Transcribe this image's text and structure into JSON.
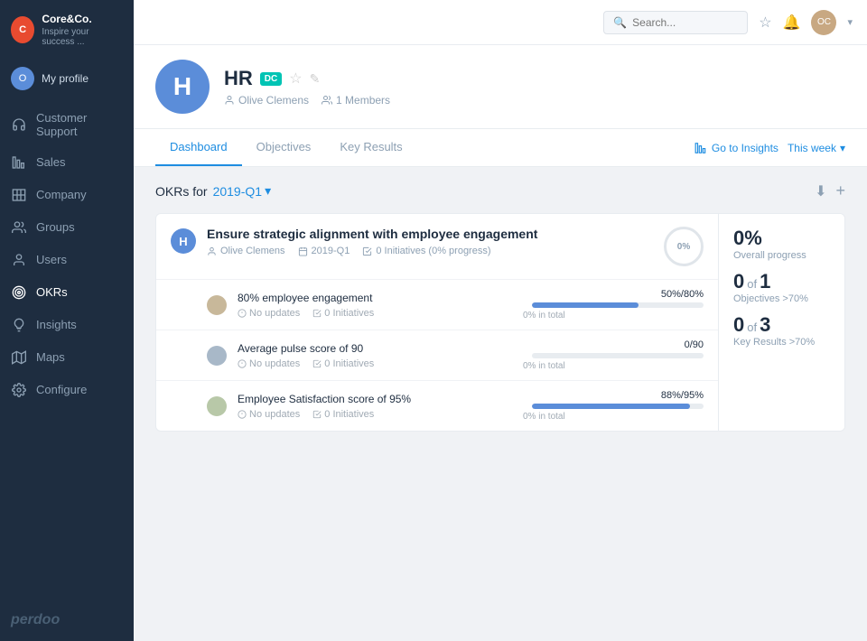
{
  "sidebar": {
    "logo_initials": "C",
    "company_name": "Core&Co.",
    "company_tagline": "Inspire your success ...",
    "profile": {
      "initials": "O",
      "name": "My profile"
    },
    "nav_items": [
      {
        "id": "customer-support",
        "label": "Customer Support",
        "icon": "headset"
      },
      {
        "id": "sales",
        "label": "Sales",
        "icon": "chart-bar"
      },
      {
        "id": "company",
        "label": "Company",
        "icon": "building"
      },
      {
        "id": "groups",
        "label": "Groups",
        "icon": "users"
      },
      {
        "id": "users",
        "label": "Users",
        "icon": "user"
      },
      {
        "id": "okrs",
        "label": "OKRs",
        "icon": "target"
      },
      {
        "id": "insights",
        "label": "Insights",
        "icon": "lightbulb"
      },
      {
        "id": "maps",
        "label": "Maps",
        "icon": "map"
      },
      {
        "id": "configure",
        "label": "Configure",
        "icon": "gear"
      }
    ],
    "footer_logo": "perdoo"
  },
  "topbar": {
    "search_placeholder": "Search...",
    "avatar_initials": "OC"
  },
  "group": {
    "avatar_letter": "H",
    "title": "HR",
    "badge": "DC",
    "owner": "Olive Clemens",
    "members": "1 Members"
  },
  "tabs": [
    {
      "id": "dashboard",
      "label": "Dashboard",
      "active": true
    },
    {
      "id": "objectives",
      "label": "Objectives"
    },
    {
      "id": "key-results",
      "label": "Key Results"
    }
  ],
  "tab_actions": {
    "go_insights": "Go to Insights",
    "this_week": "This week"
  },
  "okrs": {
    "section_label": "OKRs for",
    "period": "2019-Q1",
    "objectives": [
      {
        "id": "obj1",
        "avatar_letter": "H",
        "title": "Ensure strategic alignment with employee engagement",
        "owner": "Olive Clemens",
        "period": "2019-Q1",
        "initiatives": "0 Initiatives (0% progress)",
        "progress_pct": "0%",
        "key_results": [
          {
            "id": "kr1",
            "title": "80% employee engagement",
            "no_updates": "No updates",
            "initiatives": "0 Initiatives",
            "progress_label": "50%/80%",
            "progress_bar_pct": 62,
            "progress_total": "0% in total"
          },
          {
            "id": "kr2",
            "title": "Average pulse score of 90",
            "no_updates": "No updates",
            "initiatives": "0 Initiatives",
            "progress_label": "0/90",
            "progress_bar_pct": 0,
            "progress_total": "0% in total"
          },
          {
            "id": "kr3",
            "title": "Employee Satisfaction score of 95%",
            "no_updates": "No updates",
            "initiatives": "0 Initiatives",
            "progress_label": "88%/95%",
            "progress_bar_pct": 92,
            "progress_total": "0% in total"
          }
        ]
      }
    ],
    "stats": {
      "overall_progress_value": "0%",
      "overall_progress_label": "Overall progress",
      "objectives_value": "0",
      "objectives_of": "of",
      "objectives_total": "1",
      "objectives_label": "Objectives >70%",
      "key_results_value": "0",
      "key_results_of": "of",
      "key_results_total": "3",
      "key_results_label": "Key Results >70%"
    }
  }
}
